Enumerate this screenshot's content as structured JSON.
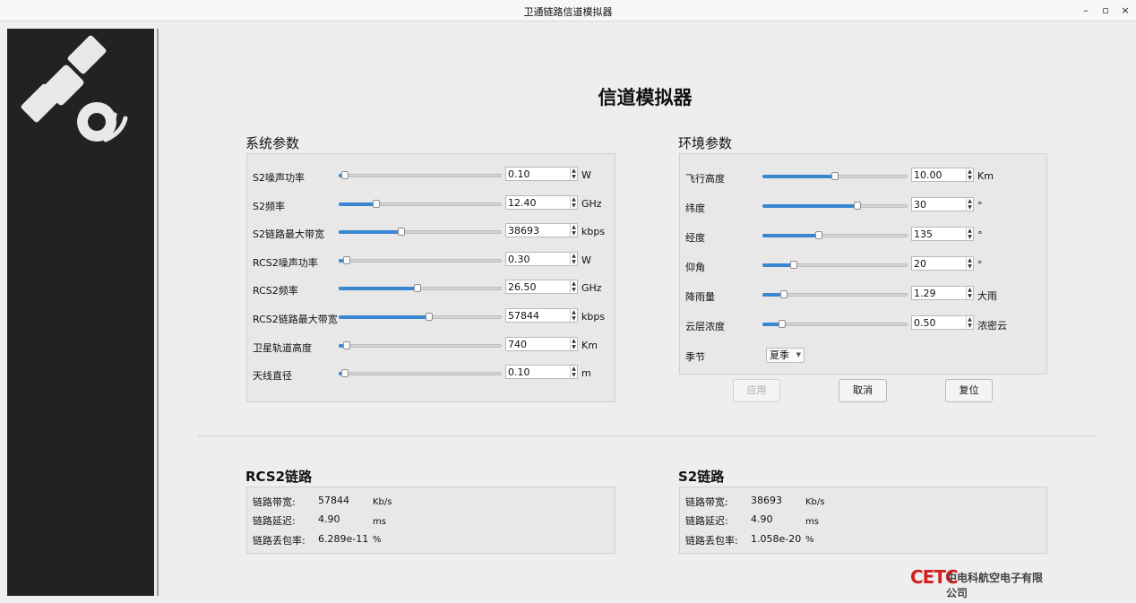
{
  "window": {
    "title": "卫通链路信道模拟器",
    "controls": [
      "–",
      "▫",
      "×"
    ]
  },
  "main_title": "信道模拟器",
  "system_params": {
    "title": "系统参数",
    "rows": [
      {
        "label": "S2噪声功率",
        "value": "0.10",
        "unit": "W",
        "level": 0.02
      },
      {
        "label": "S2频率",
        "value": "12.40",
        "unit": "GHz",
        "level": 0.22
      },
      {
        "label": "S2链路最大带宽",
        "value": "38693",
        "unit": "kbps",
        "level": 0.38
      },
      {
        "label": "RCS2噪声功率",
        "value": "0.30",
        "unit": "W",
        "level": 0.03
      },
      {
        "label": "RCS2频率",
        "value": "26.50",
        "unit": "GHz",
        "level": 0.48
      },
      {
        "label": "RCS2链路最大带宽",
        "value": "57844",
        "unit": "kbps",
        "level": 0.56
      },
      {
        "label": "卫星轨道高度",
        "value": "740",
        "unit": "Km",
        "level": 0.03
      },
      {
        "label": "天线直径",
        "value": "0.10",
        "unit": "m",
        "level": 0.02
      }
    ]
  },
  "env_params": {
    "title": "环境参数",
    "rows": [
      {
        "label": "飞行高度",
        "value": "10.00",
        "unit": "Km",
        "level": 0.5
      },
      {
        "label": "纬度",
        "value": "30",
        "unit": "°",
        "level": 0.66
      },
      {
        "label": "经度",
        "value": "135",
        "unit": "°",
        "level": 0.38
      },
      {
        "label": "仰角",
        "value": "20",
        "unit": "°",
        "level": 0.2
      },
      {
        "label": "降雨量",
        "value": "1.29",
        "unit": "大雨",
        "level": 0.13
      },
      {
        "label": "云层浓度",
        "value": "0.50",
        "unit": "浓密云",
        "level": 0.12
      }
    ],
    "season_label": "季节",
    "season_value": "夏季"
  },
  "buttons": {
    "apply": "应用",
    "cancel": "取消",
    "reset": "复位"
  },
  "rcs2_link": {
    "title": "RCS2链路",
    "bandwidth_label": "链路带宽:",
    "bandwidth_value": "57844",
    "bandwidth_unit": "Kb/s",
    "delay_label": "链路延迟:",
    "delay_value": "4.90",
    "delay_unit": "ms",
    "loss_label": "链路丢包率:",
    "loss_value": "6.289e-11",
    "loss_unit": "%"
  },
  "s2_link": {
    "title": "S2链路",
    "bandwidth_label": "链路带宽:",
    "bandwidth_value": "38693",
    "bandwidth_unit": "Kb/s",
    "delay_label": "链路延迟:",
    "delay_value": "4.90",
    "delay_unit": "ms",
    "loss_label": "链路丢包率:",
    "loss_value": "1.058e-20",
    "loss_unit": "%"
  },
  "brand": {
    "mark": "CETC",
    "name": "中电科航空电子有限公司"
  },
  "colors": {
    "accent": "#3a86d0",
    "sidebar": "#222222",
    "brand": "#d22020"
  }
}
